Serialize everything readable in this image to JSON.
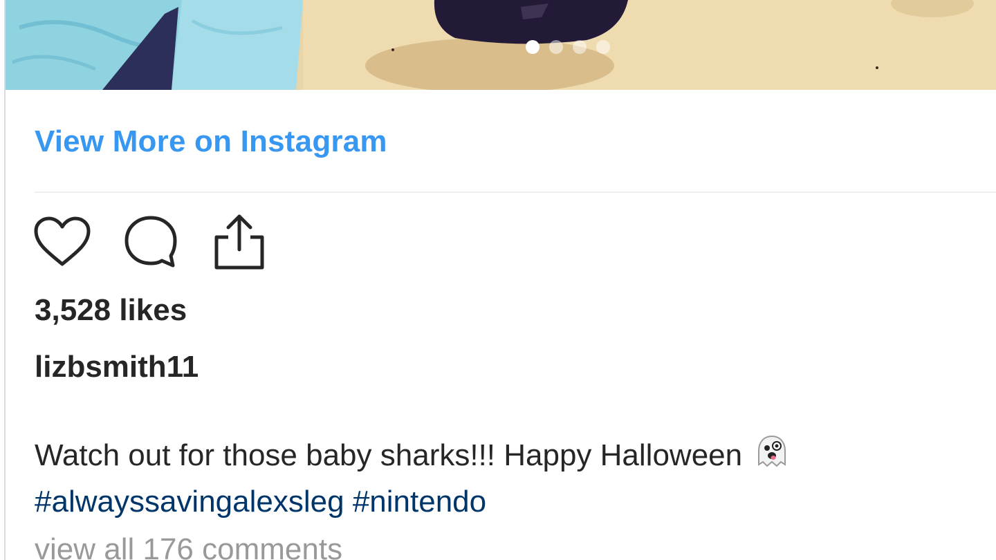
{
  "post": {
    "carousel": {
      "slide_count": 4,
      "active_index": 0
    },
    "view_more_label": "View More on Instagram",
    "actions": {
      "like_icon": "heart-icon",
      "comment_icon": "comment-bubble-icon",
      "share_icon": "share-upload-icon"
    },
    "likes_text": "3,528 likes",
    "username": "lizbsmith11",
    "caption": {
      "text": "Watch out for those baby sharks!!! Happy Halloween",
      "emoji_icon": "ghost-emoji-icon",
      "hashtags": [
        "#alwayssavingalexsleg",
        "#nintendo"
      ]
    },
    "comments_link": "view all 176 comments"
  },
  "colors": {
    "link_blue": "#3897f0",
    "hashtag_blue": "#003569",
    "text_dark": "#262626",
    "text_muted": "#999999",
    "divider": "#efefef"
  }
}
